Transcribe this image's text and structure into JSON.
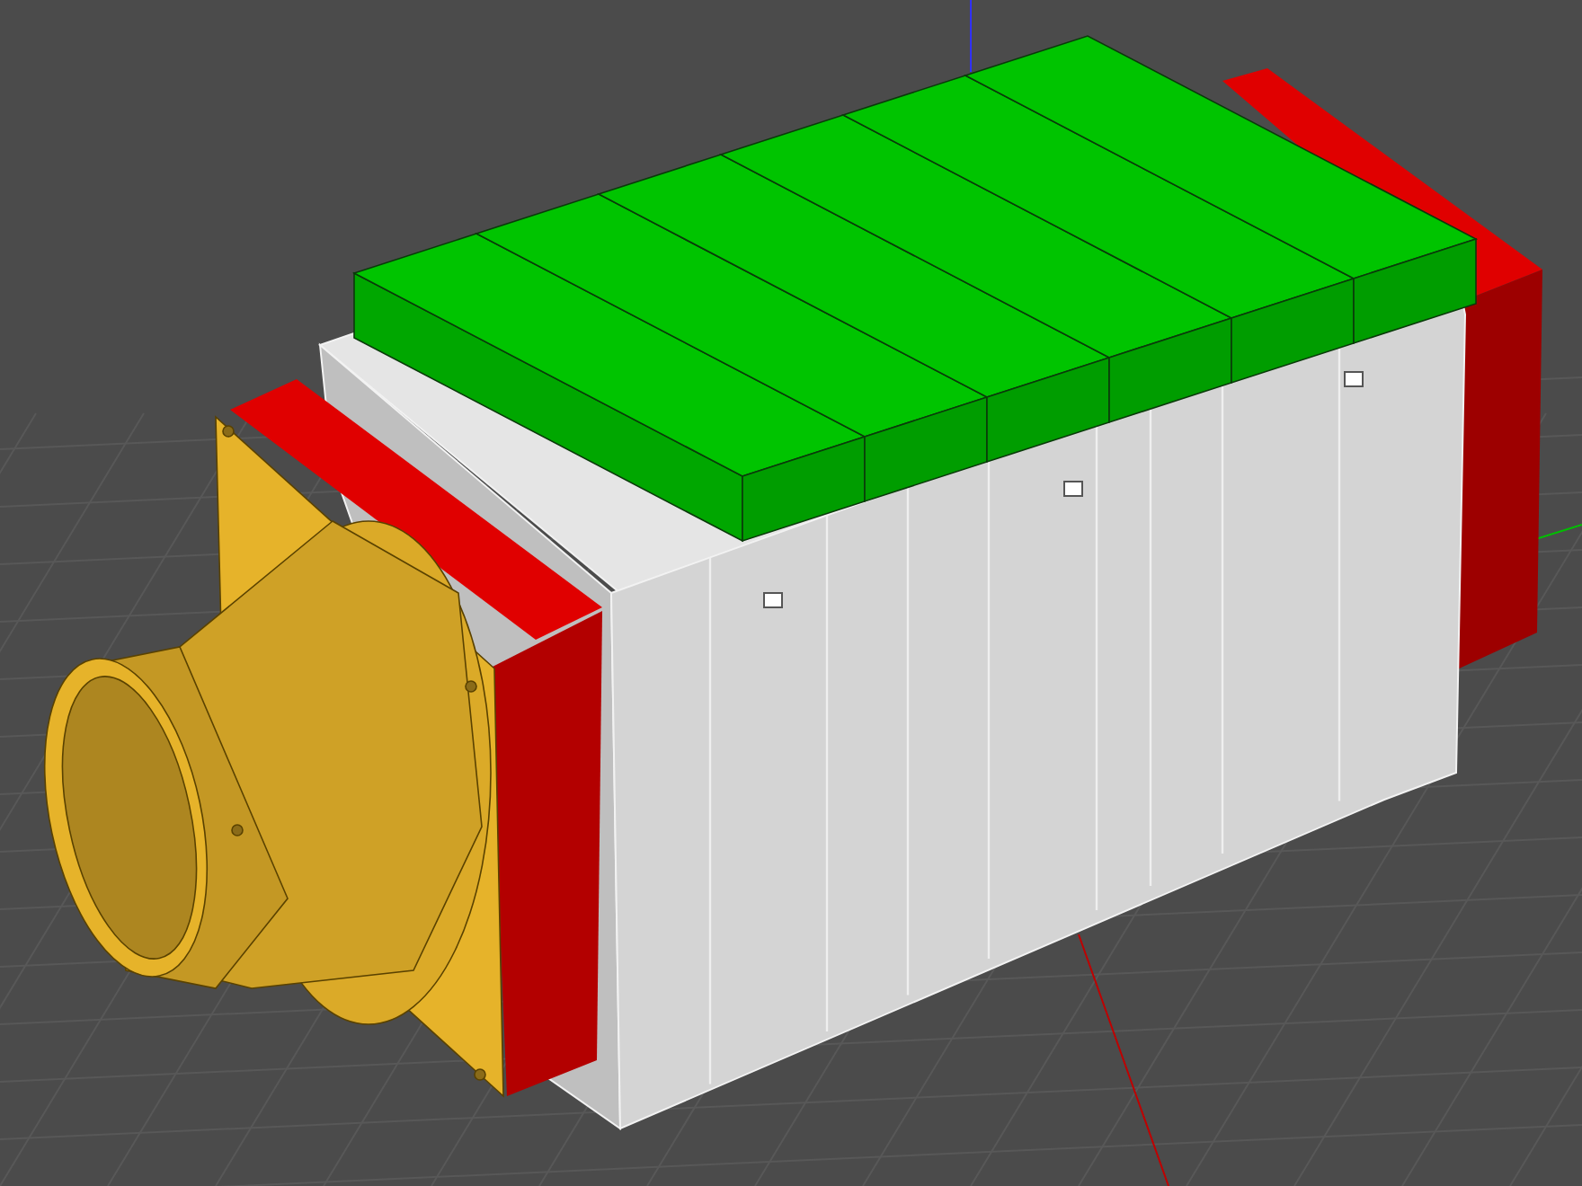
{
  "model": {
    "parts": [
      {
        "kind": "end_plate_right"
      },
      {
        "kind": "housing"
      },
      {
        "kind": "block"
      },
      {
        "kind": "block"
      },
      {
        "kind": "block"
      },
      {
        "kind": "block"
      },
      {
        "kind": "block"
      },
      {
        "kind": "block"
      },
      {
        "kind": "end_plate_left"
      },
      {
        "kind": "fan_adapter"
      }
    ]
  }
}
